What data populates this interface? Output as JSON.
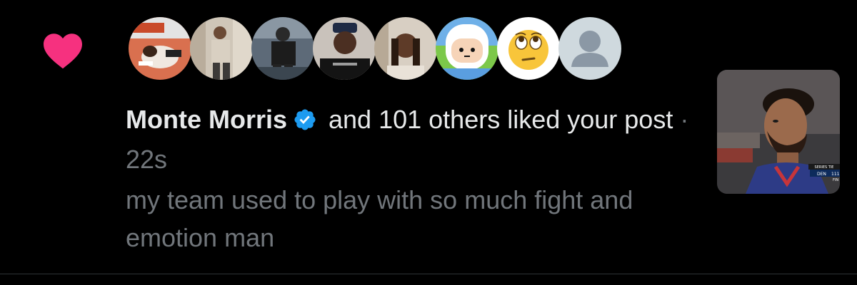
{
  "notification": {
    "type_icon": "heart-icon",
    "like_color": "#f91880",
    "actor_name": "Monte Morris",
    "actor_verified_icon": "verified-badge-icon",
    "verified_color": "#1d9bf0",
    "action_text": " and 101 others liked your post",
    "separator": " · ",
    "timestamp": "22s",
    "post_text": "my team used to play with so much fight and emotion man",
    "avatars": [
      {
        "name": "avatar-1",
        "icon": "photo-avatar"
      },
      {
        "name": "avatar-2",
        "icon": "photo-avatar"
      },
      {
        "name": "avatar-3",
        "icon": "photo-avatar"
      },
      {
        "name": "avatar-4",
        "icon": "photo-avatar"
      },
      {
        "name": "avatar-5",
        "icon": "photo-avatar"
      },
      {
        "name": "avatar-6",
        "icon": "cartoon-avatar"
      },
      {
        "name": "avatar-7",
        "icon": "eye-roll-emoji-avatar"
      },
      {
        "name": "avatar-8",
        "icon": "default-profile-avatar"
      }
    ],
    "media_thumbnail": {
      "description_icon": "video-thumbnail",
      "scorebug_team": "DEN",
      "scorebug_score": "111",
      "scorebug_label": "SERIES TIE",
      "scorebug_extra": "FIN"
    }
  }
}
